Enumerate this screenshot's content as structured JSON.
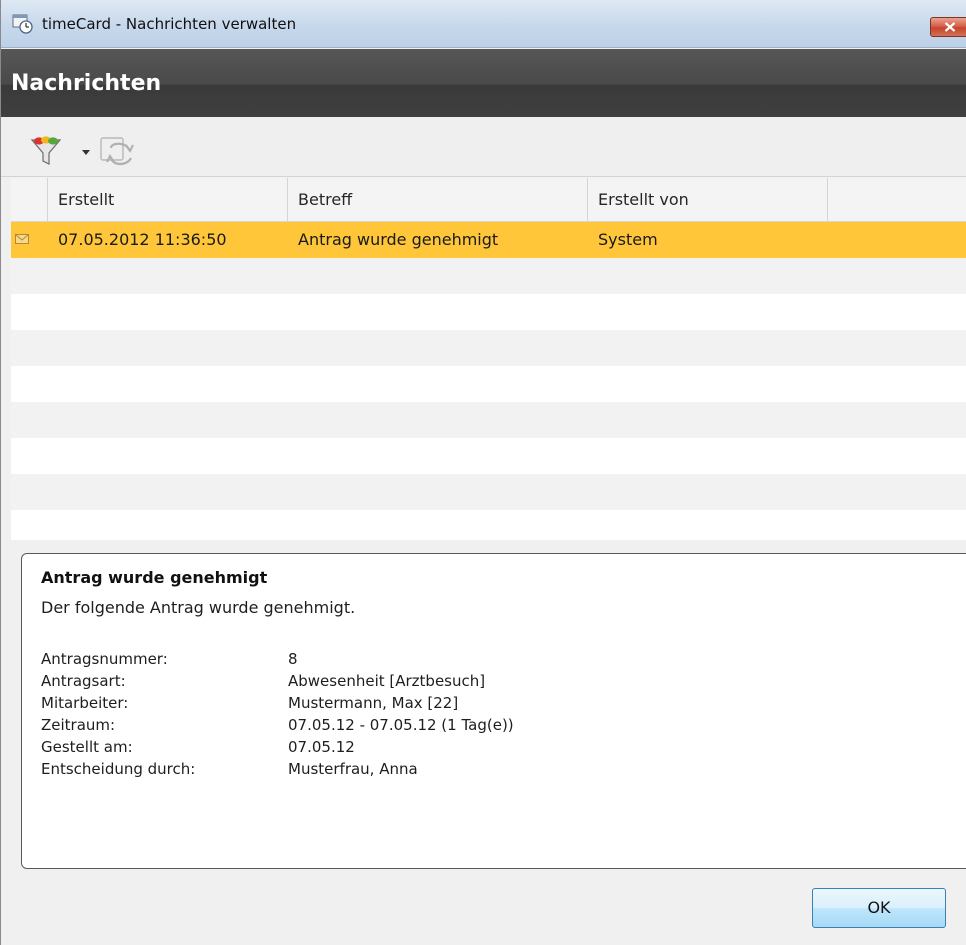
{
  "window": {
    "title": "timeCard - Nachrichten verwalten"
  },
  "header": {
    "title": "Nachrichten"
  },
  "toolbar": {
    "icons": [
      "filter-icon",
      "dropdown-arrow-icon",
      "refresh-icon"
    ]
  },
  "grid": {
    "columns": [
      "",
      "Erstellt",
      "Betreff",
      "Erstellt von",
      ""
    ],
    "rows": [
      {
        "icon": "envelope-icon",
        "created": "07.05.2012 11:36:50",
        "subject": "Antrag wurde genehmigt",
        "created_by": "System"
      }
    ]
  },
  "details": {
    "title": "Antrag wurde genehmigt",
    "description": "Der folgende Antrag wurde genehmigt.",
    "fields": [
      {
        "label": "Antragsnummer:",
        "value": "8"
      },
      {
        "label": "Antragsart:",
        "value": "Abwesenheit [Arztbesuch]"
      },
      {
        "label": "Mitarbeiter:",
        "value": "Mustermann, Max [22]"
      },
      {
        "label": "Zeitraum:",
        "value": "07.05.12 - 07.05.12 (1 Tag(e))"
      },
      {
        "label": "Gestellt am:",
        "value": "07.05.12"
      },
      {
        "label": "Entscheidung durch:",
        "value": "Musterfrau, Anna"
      }
    ]
  },
  "buttons": {
    "ok_label": "OK"
  },
  "colors": {
    "selected_row": "#fec638",
    "header_bg": "#4a4a4a",
    "close_button": "#c5452d"
  }
}
